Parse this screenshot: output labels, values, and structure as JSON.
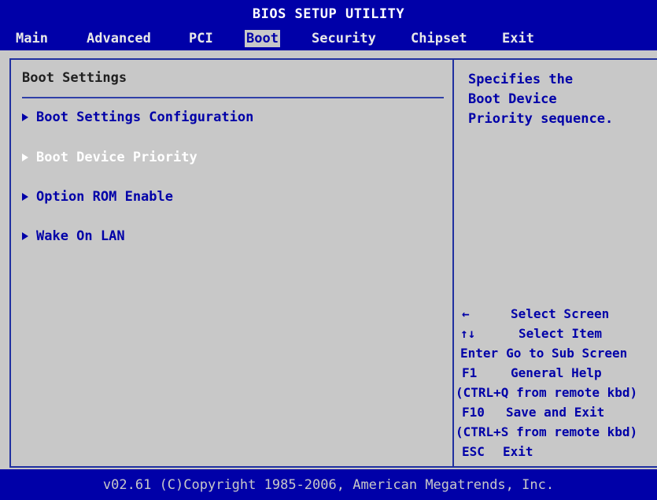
{
  "window": {
    "title": "BIOS SETUP UTILITY"
  },
  "menu": [
    {
      "label": "Main",
      "active": false
    },
    {
      "label": "Advanced",
      "active": false
    },
    {
      "label": "PCI",
      "active": false
    },
    {
      "label": "Boot",
      "active": true
    },
    {
      "label": "Security",
      "active": false
    },
    {
      "label": "Chipset",
      "active": false
    },
    {
      "label": "Exit",
      "active": false
    }
  ],
  "section": {
    "title": "Boot Settings",
    "items": [
      {
        "label": "Boot Settings Configuration",
        "selected": false
      },
      {
        "label": "Boot Device Priority",
        "selected": true
      },
      {
        "label": "Option ROM Enable",
        "selected": false
      },
      {
        "label": "Wake On LAN",
        "selected": false
      }
    ]
  },
  "help": {
    "text": "Specifies the\nBoot Device\nPriority sequence."
  },
  "keys": [
    {
      "key": "←",
      "desc": "Select Screen"
    },
    {
      "key": "↑↓",
      "desc": "Select Item"
    },
    {
      "key": "Enter",
      "desc": "Go to Sub Screen"
    },
    {
      "key": "F1",
      "desc": "General Help"
    },
    {
      "key": "",
      "desc": "(CTRL+Q from remote kbd)"
    },
    {
      "key": "F10",
      "desc": "Save and Exit"
    },
    {
      "key": "",
      "desc": "(CTRL+S from remote kbd)"
    },
    {
      "key": "ESC",
      "desc": "Exit"
    }
  ],
  "footer": {
    "text": "v02.61 (C)Copyright 1985-2006, American Megatrends, Inc."
  },
  "colors": {
    "bios_blue": "#0000a8",
    "panel_gray": "#c8c8c8",
    "highlight_white": "#ffffff"
  }
}
